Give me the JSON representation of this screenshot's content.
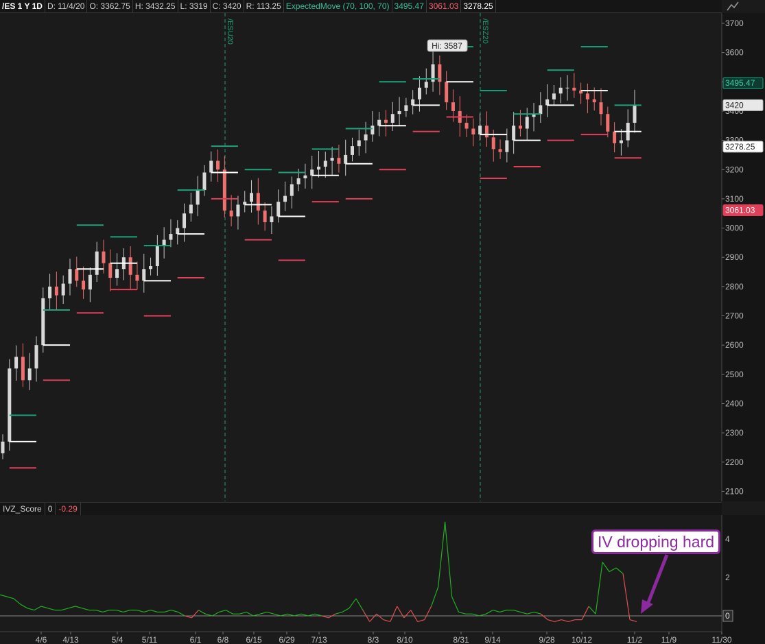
{
  "header": {
    "symbol": "/ES 1 Y 1D",
    "date": "D: 11/4/20",
    "open": "O: 3362.75",
    "high": "H: 3432.25",
    "low": "L: 3319",
    "close": "C: 3420",
    "range": "R: 113.25",
    "study": "ExpectedMove (70, 100, 70)",
    "em_upper": "3495.47",
    "em_lower": "3061.03",
    "em_mid": "3278.25"
  },
  "price_axis": {
    "ticks": [
      "3700",
      "3600",
      "3500",
      "3400",
      "3300",
      "3200",
      "3100",
      "3000",
      "2900",
      "2800",
      "2700",
      "2600",
      "2500",
      "2400",
      "2300",
      "2200",
      "2100"
    ],
    "labels": {
      "upper": "3495.47",
      "close": "3420",
      "mid": "3278.25",
      "lower": "3061.03"
    }
  },
  "annotations": {
    "hi_label": "Hi: 3587",
    "rollover_1": "/ESU20",
    "rollover_2": "/ESZ20"
  },
  "oscillator": {
    "name": "IVZ_Score",
    "value_1": "0",
    "value_2": "-0.29",
    "ticks": [
      "4",
      "2",
      "0"
    ]
  },
  "time_axis": [
    "4/6",
    "4/13",
    "5/4",
    "5/11",
    "6/1",
    "6/8",
    "6/15",
    "6/29",
    "7/13",
    "8/3",
    "8/10",
    "8/31",
    "9/14",
    "9/28",
    "10/12",
    "11/2",
    "11/9",
    "11/30"
  ],
  "callout": {
    "text": "IV dropping hard"
  },
  "colors": {
    "up": "#c8c8c8",
    "down": "#f06a6a",
    "em_upper": "#1fa37c",
    "em_lower": "#e0405a",
    "osc_up": "#22b022",
    "osc_down": "#e05050",
    "callout": "#8b2a9e"
  },
  "chart_data": {
    "type": "candlestick",
    "ylim": [
      2100,
      3720
    ],
    "xlabel": "",
    "ylabel": "",
    "close_series": [
      2270,
      2520,
      2560,
      2480,
      2520,
      2600,
      2760,
      2800,
      2770,
      2810,
      2860,
      2820,
      2790,
      2840,
      2920,
      2880,
      2830,
      2860,
      2900,
      2840,
      2820,
      2860,
      2870,
      2940,
      2960,
      2980,
      3000,
      3050,
      3080,
      3130,
      3190,
      3230,
      3200,
      3060,
      3040,
      3080,
      3090,
      3120,
      3060,
      3020,
      3040,
      3090,
      3110,
      3150,
      3170,
      3180,
      3200,
      3210,
      3230,
      3240,
      3220,
      3250,
      3280,
      3300,
      3320,
      3350,
      3370,
      3360,
      3390,
      3400,
      3420,
      3440,
      3480,
      3500,
      3560,
      3500,
      3430,
      3400,
      3360,
      3340,
      3320,
      3350,
      3310,
      3270,
      3260,
      3300,
      3350,
      3340,
      3380,
      3390,
      3420,
      3440,
      3460,
      3480,
      3480,
      3470,
      3460,
      3440,
      3430,
      3390,
      3330,
      3290,
      3300,
      3360,
      3420
    ],
    "osc_series": [
      1.1,
      1.0,
      0.9,
      0.6,
      0.4,
      0.3,
      0.5,
      0.4,
      0.3,
      0.3,
      0.4,
      0.5,
      0.4,
      0.3,
      0.3,
      0.2,
      0.3,
      0.3,
      0.2,
      0.3,
      0.3,
      0.2,
      0.3,
      0.2,
      0.2,
      0.3,
      0.2,
      0.0,
      -0.1,
      0.3,
      0.1,
      0.0,
      0.2,
      0.3,
      0.1,
      0.1,
      0.2,
      0.0,
      0.1,
      0.2,
      0.1,
      0.0,
      0.1,
      0.0,
      0.1,
      0.0,
      0.1,
      0.0,
      -0.1,
      0.1,
      0.2,
      0.4,
      0.9,
      0.3,
      -0.3,
      0.1,
      -0.2,
      -0.3,
      0.5,
      -0.1,
      0.3,
      -0.3,
      -0.2,
      0.5,
      1.5,
      4.9,
      1.0,
      0.2,
      0.1,
      0.1,
      0.0,
      0.1,
      0.3,
      0.2,
      0.3,
      0.3,
      0.2,
      0.1,
      0.2,
      0.1,
      -0.2,
      -0.3,
      -0.2,
      -0.3,
      -0.2,
      -0.2,
      0.5,
      0.1,
      2.8,
      2.3,
      2.5,
      2.2,
      -0.2,
      -0.3
    ],
    "expected_move_upper": "3495.47",
    "expected_move_lower": "3061.03"
  }
}
